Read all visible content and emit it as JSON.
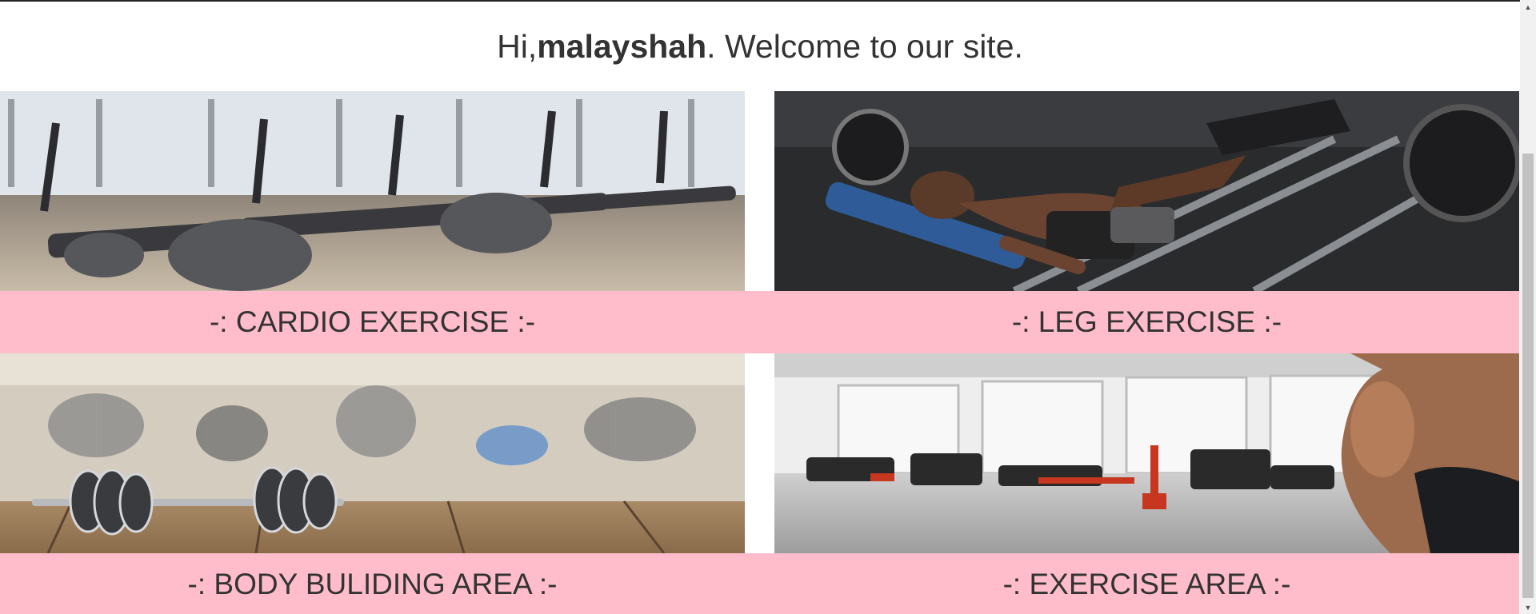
{
  "header": {
    "greeting_prefix": "Hi, ",
    "username": "malayshah",
    "greeting_suffix": ". Welcome to our site."
  },
  "tiles": [
    {
      "caption": "-: CARDIO EXERCISE :-"
    },
    {
      "caption": "-: LEG EXERCISE :-"
    },
    {
      "caption": "-: BODY BULIDING AREA :-"
    },
    {
      "caption": "-: EXERCISE AREA :-"
    }
  ],
  "colors": {
    "caption_background": "#ffbccb",
    "text": "#333333"
  },
  "icons": {
    "scroll_up": "triangle-up-icon",
    "scroll_down": "triangle-down-icon"
  }
}
